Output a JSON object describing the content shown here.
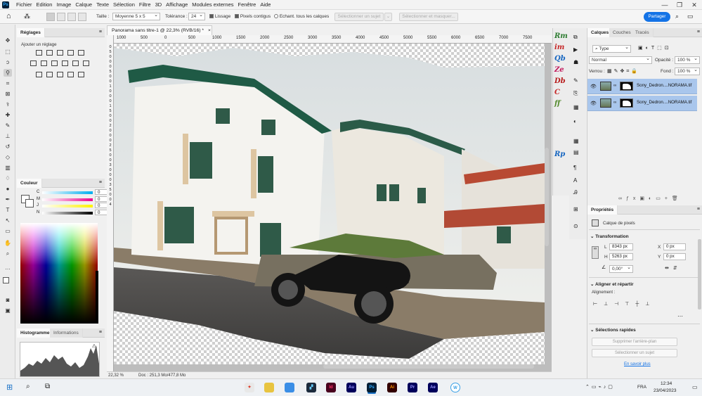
{
  "menubar": {
    "app_icon": "Ps",
    "items": [
      "Fichier",
      "Edition",
      "Image",
      "Calque",
      "Texte",
      "Sélection",
      "Filtre",
      "3D",
      "Affichage",
      "Modules externes",
      "Fenêtre",
      "Aide"
    ],
    "window_controls": [
      "—",
      "❐",
      "✕"
    ]
  },
  "options": {
    "size_label": "Taille :",
    "size_value": "Moyenne 5 x 5",
    "tolerance_label": "Tolérance :",
    "tolerance_value": "24",
    "smoothing_label": "Lissage",
    "contiguous_label": "Pixels contigus",
    "sample_all_label": "Echant. tous les calques",
    "select_subject": "Sélectionner un sujet",
    "select_mask": "Sélectionner et masquer...",
    "share": "Partager"
  },
  "left_panels": {
    "adjustments_tab": "Réglages",
    "adjustments_hint": "Ajouter un réglage",
    "color_tab": "Couleur",
    "cmyk_labels": [
      "C",
      "M",
      "J",
      "N"
    ],
    "cmyk_values": [
      "0",
      "0",
      "0",
      "0"
    ],
    "percent": "%",
    "histogram_tab": "Histogramme",
    "info_tab": "Informations"
  },
  "document": {
    "tab_title": "Panorama sans titre-1 @ 22,3% (RVB/16) *",
    "close": "×",
    "ruler_h": [
      "1000",
      "500",
      "0",
      "500",
      "1000",
      "1500",
      "2000",
      "2500",
      "3000",
      "3500",
      "4000",
      "4500",
      "5000",
      "5500",
      "6000",
      "6500",
      "7000",
      "7500"
    ],
    "ruler_v": [
      "0",
      "5",
      "0",
      "0",
      "0",
      "5",
      "0",
      "0",
      "1",
      "0",
      "0",
      "0",
      "1",
      "5",
      "0",
      "0",
      "2",
      "0",
      "0",
      "0",
      "2",
      "5",
      "0",
      "0",
      "3",
      "0",
      "0",
      "0",
      "3",
      "5",
      "0",
      "0",
      "4"
    ],
    "zoom": "22,32 %",
    "doc_info": "Doc : 251,3 Mo/477,8 Mo"
  },
  "plugins": {
    "labels": [
      "Rm",
      "im",
      "Qb",
      "Ze",
      "Db",
      "C",
      "ff",
      "Rp"
    ],
    "colors": [
      "#2e7d32",
      "#c62828",
      "#1565c0",
      "#c2185b",
      "#b71c1c",
      "#c62828",
      "#558b2f",
      "#1565c0"
    ]
  },
  "layers_panel": {
    "tabs": [
      "Calques",
      "Couches",
      "Tracés"
    ],
    "filter": "Type",
    "blend_mode": "Normal",
    "opacity_label": "Opacité :",
    "opacity_value": "100 %",
    "lock_label": "Verrou :",
    "fill_label": "Fond :",
    "fill_value": "100 %",
    "layers": [
      "Sony_Dedron....NORAMA.tif",
      "Sony_Dedron....NORAMA.tif"
    ]
  },
  "properties_panel": {
    "tab": "Propriétés",
    "kind": "Calque de pixels",
    "transform_title": "Transformation",
    "w_label": "L",
    "w_value": "8343 px",
    "h_label": "H",
    "h_value": "5263 px",
    "x_label": "X",
    "x_value": "0 px",
    "y_label": "Y",
    "y_value": "0 px",
    "angle_value": "0,00°",
    "align_title": "Aligner et répartir",
    "align_label": "Alignement :",
    "quick_title": "Sélections rapides",
    "remove_bg": "Supprimer l'arrière-plan",
    "select_subject": "Sélectionner un sujet",
    "learn_more": "En savoir plus"
  },
  "taskbar": {
    "apps": [
      "Id",
      "Au",
      "Ps",
      "Ai",
      "Pr",
      "Ae"
    ],
    "app_colors": [
      "#49021f",
      "#00005b",
      "#001e36",
      "#330000",
      "#00005b",
      "#00005b"
    ],
    "app_fg": [
      "#ff3366",
      "#9999ff",
      "#31a8ff",
      "#ff9a00",
      "#9999ff",
      "#9999ff"
    ],
    "lang": "FRA",
    "time": "12:34",
    "date": "23/04/2023"
  }
}
